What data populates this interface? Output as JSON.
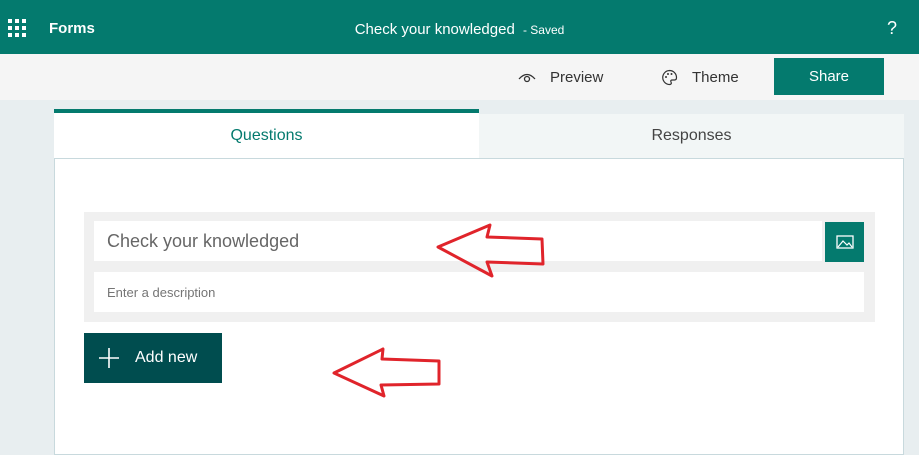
{
  "topbar": {
    "app_name": "Forms",
    "doc_title": "Check your knowledged",
    "status": "- Saved",
    "help": "?"
  },
  "commands": {
    "preview": "Preview",
    "theme": "Theme",
    "share": "Share"
  },
  "tabs": {
    "questions": "Questions",
    "responses": "Responses"
  },
  "form": {
    "title_value": "Check your knowledged",
    "description_placeholder": "Enter a description",
    "add_new": "Add new"
  },
  "colors": {
    "brand": "#047a6e",
    "add_button": "#004d4f",
    "annotation_arrow": "#e0242b"
  }
}
